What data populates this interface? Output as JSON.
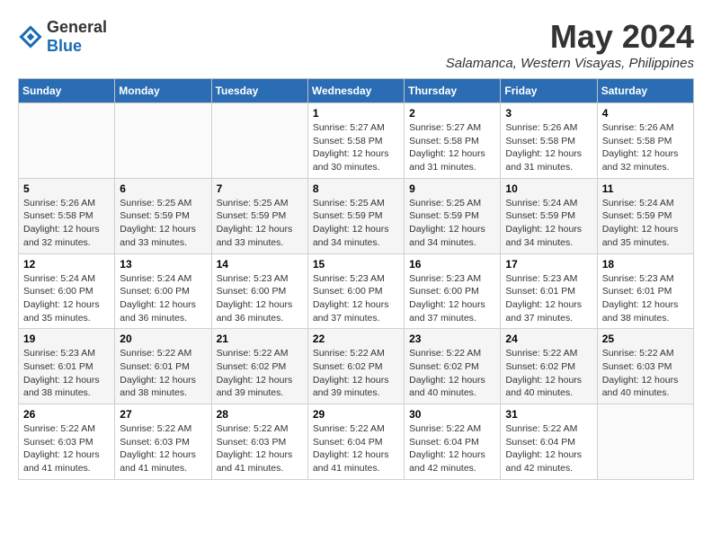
{
  "header": {
    "logo_general": "General",
    "logo_blue": "Blue",
    "month_year": "May 2024",
    "location": "Salamanca, Western Visayas, Philippines"
  },
  "days_of_week": [
    "Sunday",
    "Monday",
    "Tuesday",
    "Wednesday",
    "Thursday",
    "Friday",
    "Saturday"
  ],
  "weeks": [
    [
      {
        "day": "",
        "info": ""
      },
      {
        "day": "",
        "info": ""
      },
      {
        "day": "",
        "info": ""
      },
      {
        "day": "1",
        "info": "Sunrise: 5:27 AM\nSunset: 5:58 PM\nDaylight: 12 hours and 30 minutes."
      },
      {
        "day": "2",
        "info": "Sunrise: 5:27 AM\nSunset: 5:58 PM\nDaylight: 12 hours and 31 minutes."
      },
      {
        "day": "3",
        "info": "Sunrise: 5:26 AM\nSunset: 5:58 PM\nDaylight: 12 hours and 31 minutes."
      },
      {
        "day": "4",
        "info": "Sunrise: 5:26 AM\nSunset: 5:58 PM\nDaylight: 12 hours and 32 minutes."
      }
    ],
    [
      {
        "day": "5",
        "info": "Sunrise: 5:26 AM\nSunset: 5:58 PM\nDaylight: 12 hours and 32 minutes."
      },
      {
        "day": "6",
        "info": "Sunrise: 5:25 AM\nSunset: 5:59 PM\nDaylight: 12 hours and 33 minutes."
      },
      {
        "day": "7",
        "info": "Sunrise: 5:25 AM\nSunset: 5:59 PM\nDaylight: 12 hours and 33 minutes."
      },
      {
        "day": "8",
        "info": "Sunrise: 5:25 AM\nSunset: 5:59 PM\nDaylight: 12 hours and 34 minutes."
      },
      {
        "day": "9",
        "info": "Sunrise: 5:25 AM\nSunset: 5:59 PM\nDaylight: 12 hours and 34 minutes."
      },
      {
        "day": "10",
        "info": "Sunrise: 5:24 AM\nSunset: 5:59 PM\nDaylight: 12 hours and 34 minutes."
      },
      {
        "day": "11",
        "info": "Sunrise: 5:24 AM\nSunset: 5:59 PM\nDaylight: 12 hours and 35 minutes."
      }
    ],
    [
      {
        "day": "12",
        "info": "Sunrise: 5:24 AM\nSunset: 6:00 PM\nDaylight: 12 hours and 35 minutes."
      },
      {
        "day": "13",
        "info": "Sunrise: 5:24 AM\nSunset: 6:00 PM\nDaylight: 12 hours and 36 minutes."
      },
      {
        "day": "14",
        "info": "Sunrise: 5:23 AM\nSunset: 6:00 PM\nDaylight: 12 hours and 36 minutes."
      },
      {
        "day": "15",
        "info": "Sunrise: 5:23 AM\nSunset: 6:00 PM\nDaylight: 12 hours and 37 minutes."
      },
      {
        "day": "16",
        "info": "Sunrise: 5:23 AM\nSunset: 6:00 PM\nDaylight: 12 hours and 37 minutes."
      },
      {
        "day": "17",
        "info": "Sunrise: 5:23 AM\nSunset: 6:01 PM\nDaylight: 12 hours and 37 minutes."
      },
      {
        "day": "18",
        "info": "Sunrise: 5:23 AM\nSunset: 6:01 PM\nDaylight: 12 hours and 38 minutes."
      }
    ],
    [
      {
        "day": "19",
        "info": "Sunrise: 5:23 AM\nSunset: 6:01 PM\nDaylight: 12 hours and 38 minutes."
      },
      {
        "day": "20",
        "info": "Sunrise: 5:22 AM\nSunset: 6:01 PM\nDaylight: 12 hours and 38 minutes."
      },
      {
        "day": "21",
        "info": "Sunrise: 5:22 AM\nSunset: 6:02 PM\nDaylight: 12 hours and 39 minutes."
      },
      {
        "day": "22",
        "info": "Sunrise: 5:22 AM\nSunset: 6:02 PM\nDaylight: 12 hours and 39 minutes."
      },
      {
        "day": "23",
        "info": "Sunrise: 5:22 AM\nSunset: 6:02 PM\nDaylight: 12 hours and 40 minutes."
      },
      {
        "day": "24",
        "info": "Sunrise: 5:22 AM\nSunset: 6:02 PM\nDaylight: 12 hours and 40 minutes."
      },
      {
        "day": "25",
        "info": "Sunrise: 5:22 AM\nSunset: 6:03 PM\nDaylight: 12 hours and 40 minutes."
      }
    ],
    [
      {
        "day": "26",
        "info": "Sunrise: 5:22 AM\nSunset: 6:03 PM\nDaylight: 12 hours and 41 minutes."
      },
      {
        "day": "27",
        "info": "Sunrise: 5:22 AM\nSunset: 6:03 PM\nDaylight: 12 hours and 41 minutes."
      },
      {
        "day": "28",
        "info": "Sunrise: 5:22 AM\nSunset: 6:03 PM\nDaylight: 12 hours and 41 minutes."
      },
      {
        "day": "29",
        "info": "Sunrise: 5:22 AM\nSunset: 6:04 PM\nDaylight: 12 hours and 41 minutes."
      },
      {
        "day": "30",
        "info": "Sunrise: 5:22 AM\nSunset: 6:04 PM\nDaylight: 12 hours and 42 minutes."
      },
      {
        "day": "31",
        "info": "Sunrise: 5:22 AM\nSunset: 6:04 PM\nDaylight: 12 hours and 42 minutes."
      },
      {
        "day": "",
        "info": ""
      }
    ]
  ]
}
